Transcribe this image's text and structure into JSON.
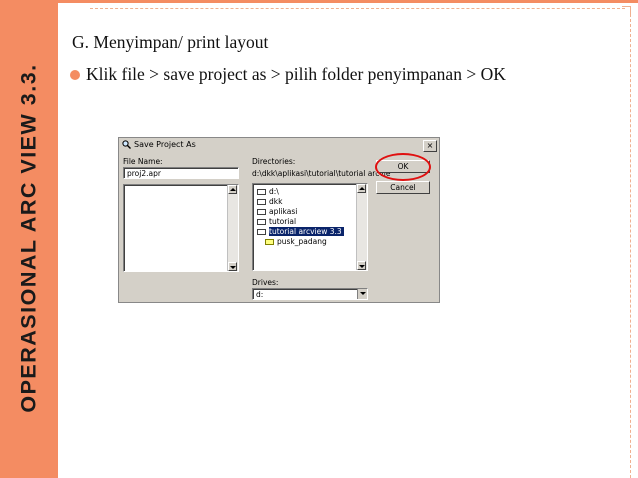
{
  "slide": {
    "side_title": "OPERASIONAL ARC VIEW 3.3.",
    "heading": "G. Menyimpan/ print layout",
    "bullet": "Klik file > save project as > pilih folder penyimpanan > OK",
    "accent_color": "#f48c62"
  },
  "dialog": {
    "title": "Save Project As",
    "title_icon": "magnifier-icon",
    "close_label": "×",
    "file_name_label": "File Name:",
    "file_name_value": "proj2.apr",
    "directories_label": "Directories:",
    "directories_path": "d:\\dkk\\aplikasi\\tutorial\\tutorial arcvie",
    "directories": [
      {
        "name": "d:\\",
        "open": true,
        "selected": false
      },
      {
        "name": "dkk",
        "open": true,
        "selected": false
      },
      {
        "name": "aplikasi",
        "open": true,
        "selected": false
      },
      {
        "name": "tutorial",
        "open": true,
        "selected": false
      },
      {
        "name": "tutorial arcview 3.3",
        "open": true,
        "selected": true
      },
      {
        "name": "pusk_padang",
        "open": false,
        "selected": false
      }
    ],
    "ok_label": "OK",
    "cancel_label": "Cancel",
    "drives_label": "Drives:",
    "drives_value": "d:",
    "highlight_color": "#e01010"
  }
}
